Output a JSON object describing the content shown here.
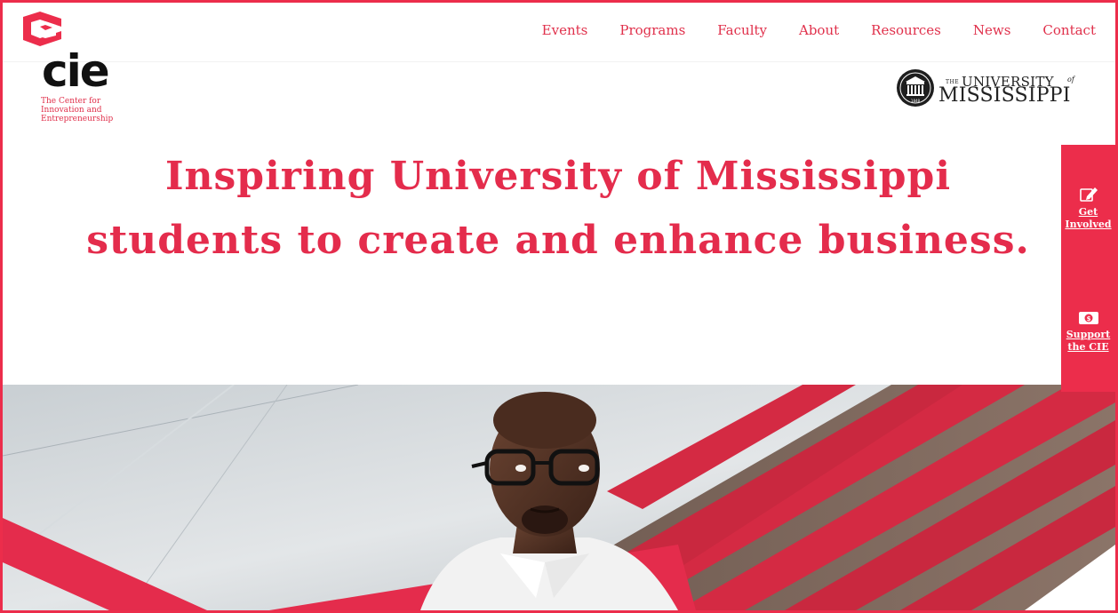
{
  "nav": {
    "items": [
      "Events",
      "Programs",
      "Faculty",
      "About",
      "Resources",
      "News",
      "Contact"
    ]
  },
  "logo": {
    "wordmark": "cie",
    "tagline_lines": [
      "The Center for",
      "Innovation and",
      "Entrepreneurship"
    ]
  },
  "partner": {
    "the": "THE",
    "university": "UNIVERSITY",
    "of": "of",
    "name": "MISSISSIPPI",
    "seal_year": "1848"
  },
  "headline": {
    "line1": "Inspiring University of Mississippi",
    "line2": "students to create and enhance business."
  },
  "sidebar": {
    "get_involved": "Get Involved",
    "support": "Support the CIE"
  },
  "colors": {
    "brand": "#ec2d4b",
    "text_red": "#e42c4c"
  }
}
